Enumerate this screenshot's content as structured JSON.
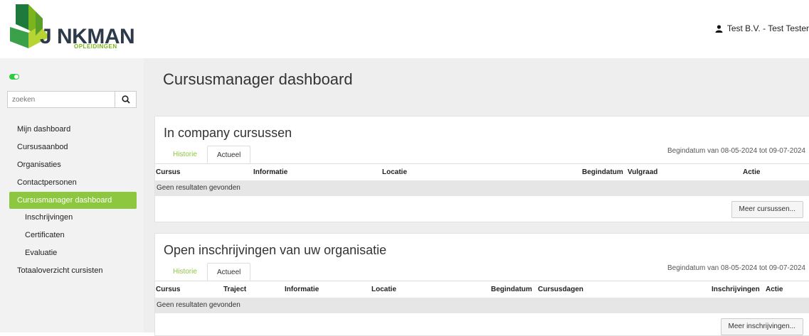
{
  "header": {
    "logo_text": "J  NKMAN",
    "logo_sub": "OPLEIDINGEN",
    "user": "Test B.V. - Test Tester"
  },
  "sidebar": {
    "search_placeholder": "zoeken",
    "items": [
      {
        "label": "Mijn dashboard"
      },
      {
        "label": "Cursusaanbod"
      },
      {
        "label": "Organisaties"
      },
      {
        "label": "Contactpersonen"
      },
      {
        "label": "Cursusmanager dashboard"
      },
      {
        "label": "Inschrijvingen"
      },
      {
        "label": "Certificaten"
      },
      {
        "label": "Evaluatie"
      },
      {
        "label": "Totaaloverzicht cursisten"
      }
    ]
  },
  "main": {
    "title": "Cursusmanager dashboard",
    "panels": [
      {
        "title": "In company cursussen",
        "tabs": [
          "Historie",
          "Actueel"
        ],
        "daterange": "Begindatum van 08-05-2024 tot 09-07-2024",
        "columns": [
          "Cursus",
          "Informatie",
          "Locatie",
          "Begindatum",
          "Vulgraad",
          "Actie"
        ],
        "empty": "Geen resultaten gevonden",
        "more": "Meer cursussen..."
      },
      {
        "title": "Open inschrijvingen van uw organisatie",
        "tabs": [
          "Historie",
          "Actueel"
        ],
        "daterange": "Begindatum van 08-05-2024 tot 09-07-2024",
        "columns": [
          "Cursus",
          "Traject",
          "Informatie",
          "Locatie",
          "Begindatum",
          "Cursusdagen",
          "Inschrijvingen",
          "Actie"
        ],
        "empty": "Geen resultaten gevonden",
        "more": "Meer inschrijvingen..."
      }
    ]
  },
  "colors": {
    "accent": "#8dc63f",
    "toggle": "#2ecc40"
  }
}
